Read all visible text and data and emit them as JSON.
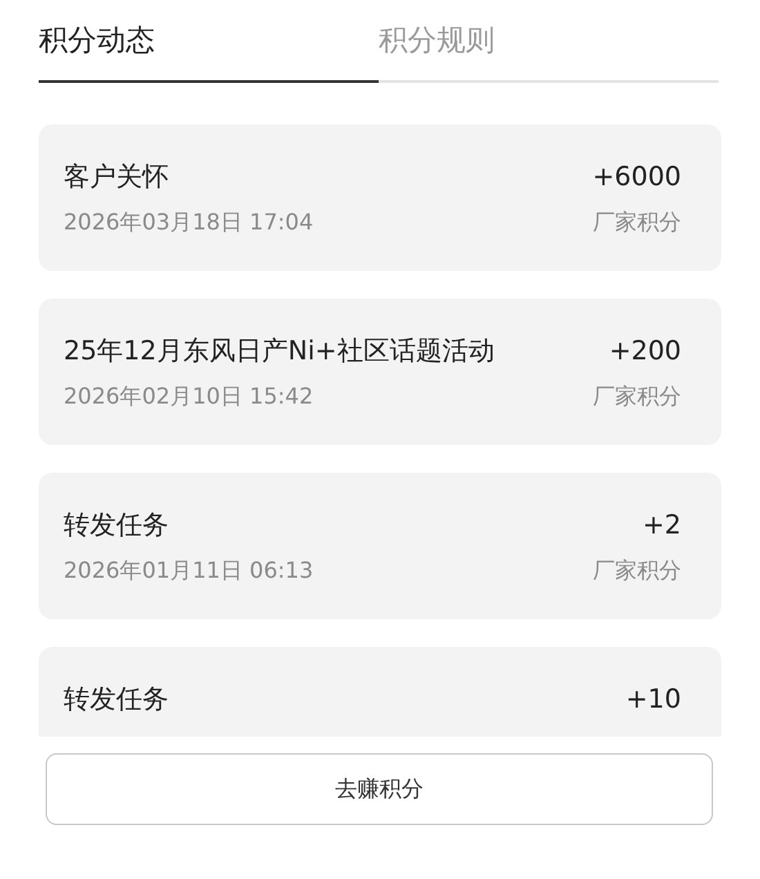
{
  "tabs": [
    {
      "label": "积分动态",
      "selected": true
    },
    {
      "label": "积分规则",
      "selected": false
    }
  ],
  "records": [
    {
      "title": "客户关怀",
      "amount": "+6000",
      "date": "2026年03月18日 17:04",
      "source": "厂家积分"
    },
    {
      "title": "25年12月东风日产Ni+社区话题活动",
      "amount": "+200",
      "date": "2026年02月10日 15:42",
      "source": "厂家积分"
    },
    {
      "title": "转发任务",
      "amount": "+2",
      "date": "2026年01月11日 06:13",
      "source": "厂家积分"
    },
    {
      "title": "转发任务",
      "amount": "+10"
    }
  ],
  "button": "去赚积分"
}
